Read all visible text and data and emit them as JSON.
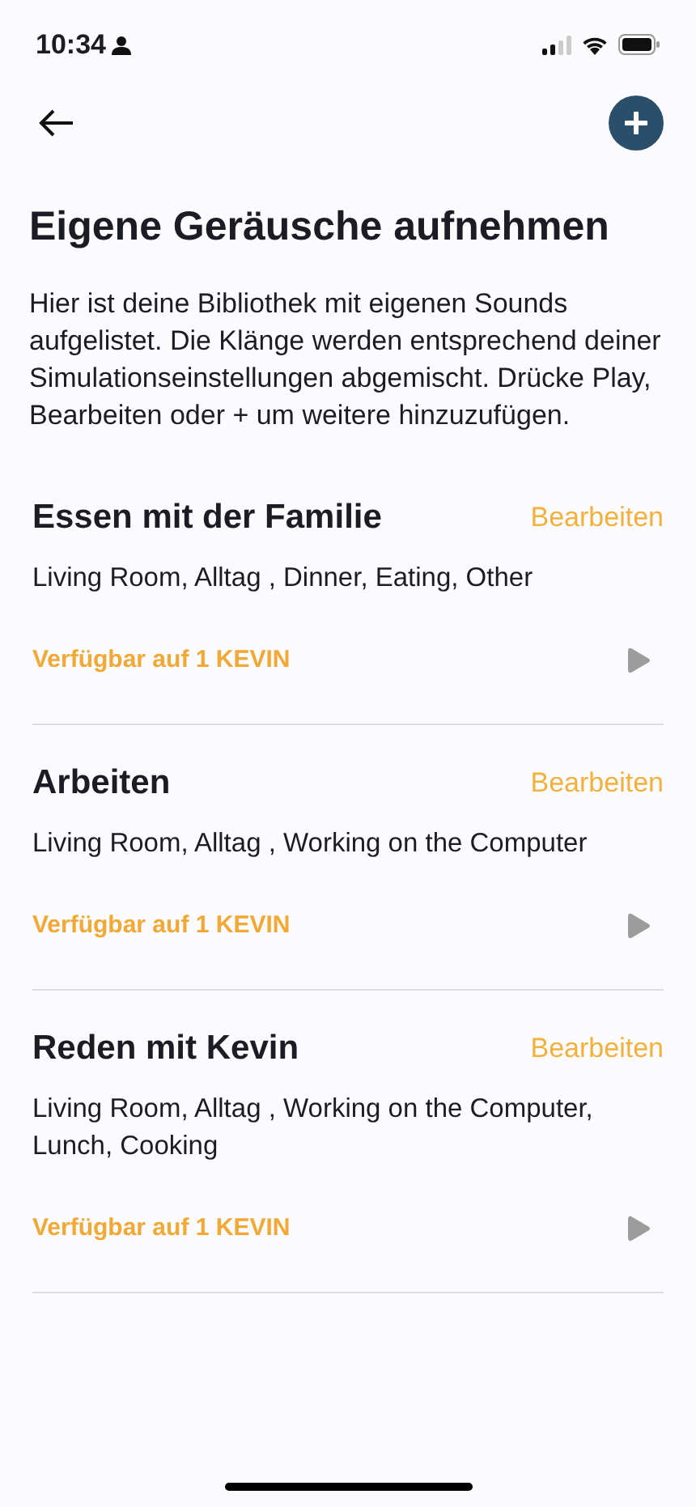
{
  "status_bar": {
    "time": "10:34"
  },
  "title": "Eigene Geräusche aufnehmen",
  "description": "Hier ist deine Bibliothek mit eigenen Sounds aufgelistet. Die Klänge werden entsprechend deiner Simulationseinstellungen abgemischt. Drücke Play, Bearbeiten oder + um weitere hinzuzufügen.",
  "sounds": [
    {
      "name": "Essen mit der Familie",
      "edit": "Bearbeiten",
      "tags": "Living Room, Alltag , Dinner, Eating, Other",
      "availability": "Verfügbar auf 1 KEVIN"
    },
    {
      "name": "Arbeiten",
      "edit": "Bearbeiten",
      "tags": "Living Room, Alltag , Working on the Computer",
      "availability": "Verfügbar auf 1 KEVIN"
    },
    {
      "name": "Reden mit Kevin",
      "edit": "Bearbeiten",
      "tags": "Living Room, Alltag , Working on the Computer, Lunch, Cooking",
      "availability": "Verfügbar auf 1 KEVIN"
    }
  ]
}
